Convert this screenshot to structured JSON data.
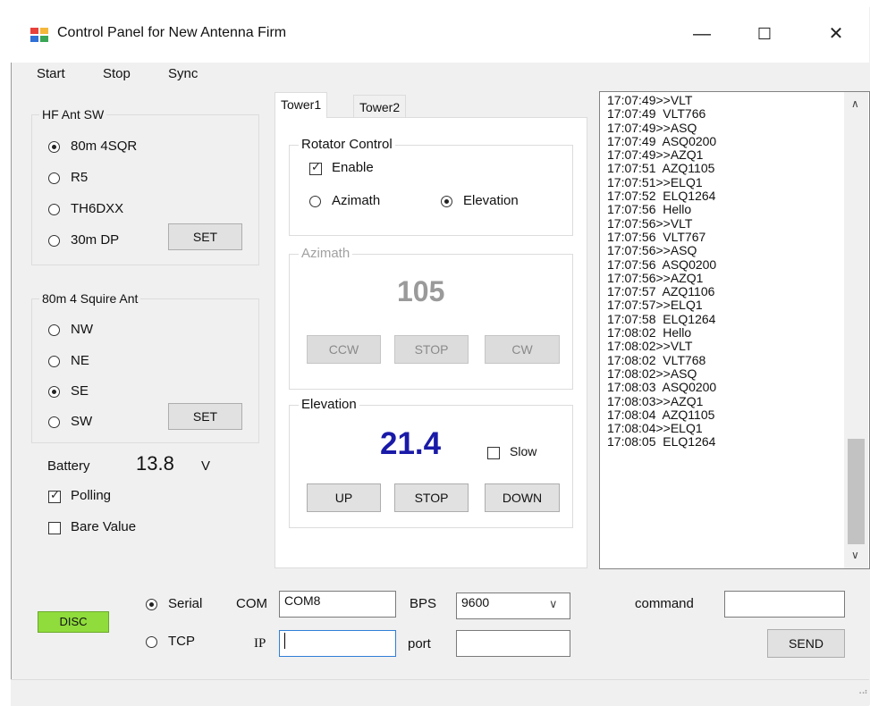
{
  "window": {
    "title": "Control Panel for New Antenna Firm",
    "minimize": "—",
    "maximize": "☐",
    "close": "✕"
  },
  "menu": [
    "Start",
    "Stop",
    "Sync"
  ],
  "hf_ant_sw": {
    "title": "HF Ant SW",
    "options": [
      "80m 4SQR",
      "R5",
      "TH6DXX",
      "30m DP"
    ],
    "selected": "80m 4SQR",
    "set_label": "SET"
  },
  "squire": {
    "title": "80m 4 Squire Ant",
    "options": [
      "NW",
      "NE",
      "SE",
      "SW"
    ],
    "selected": "SE",
    "set_label": "SET"
  },
  "battery": {
    "label": "Battery",
    "value": "13.8",
    "unit": "V"
  },
  "polling": {
    "label": "Polling",
    "checked": true
  },
  "bare_value": {
    "label": "Bare Value",
    "checked": false
  },
  "tabs": [
    "Tower1",
    "Tower2"
  ],
  "active_tab": "Tower1",
  "rotator": {
    "title": "Rotator Control",
    "enable_label": "Enable",
    "enable_checked": true,
    "modes": [
      "Azimath",
      "Elevation"
    ],
    "selected_mode": "Elevation"
  },
  "azimath": {
    "title": "Azimath",
    "value": "105",
    "buttons": [
      "CCW",
      "STOP",
      "CW"
    ],
    "enabled": false
  },
  "elevation": {
    "title": "Elevation",
    "value": "21.4",
    "slow_label": "Slow",
    "slow_checked": false,
    "buttons": [
      "UP",
      "STOP",
      "DOWN"
    ]
  },
  "log_lines": [
    "17:07:49>>VLT",
    "17:07:49  VLT766",
    "17:07:49>>ASQ",
    "17:07:49  ASQ0200",
    "17:07:49>>AZQ1",
    "17:07:51  AZQ1105",
    "17:07:51>>ELQ1",
    "17:07:52  ELQ1264",
    "17:07:56  Hello",
    "17:07:56>>VLT",
    "17:07:56  VLT767",
    "17:07:56>>ASQ",
    "17:07:56  ASQ0200",
    "17:07:56>>AZQ1",
    "17:07:57  AZQ1106",
    "17:07:57>>ELQ1",
    "17:07:58  ELQ1264",
    "17:08:02  Hello",
    "17:08:02>>VLT",
    "17:08:02  VLT768",
    "17:08:02>>ASQ",
    "17:08:03  ASQ0200",
    "17:08:03>>AZQ1",
    "17:08:04  AZQ1105",
    "17:08:04>>ELQ1",
    "17:08:05  ELQ1264"
  ],
  "connection": {
    "disc_label": "DISC",
    "disc_color": "#8fdc3c",
    "serial_label": "Serial",
    "tcp_label": "TCP",
    "selected": "Serial",
    "com_label": "COM",
    "com_value": "COM8",
    "bps_label": "BPS",
    "bps_value": "9600",
    "ip_label": "IP",
    "ip_value": "",
    "port_label": "port",
    "port_value": ""
  },
  "command": {
    "label": "command",
    "value": "",
    "send_label": "SEND"
  },
  "colors": {
    "elevation_value": "#1a1aa8",
    "azimath_value": "#9a9a9a",
    "window_bg": "#f0f0f0"
  }
}
